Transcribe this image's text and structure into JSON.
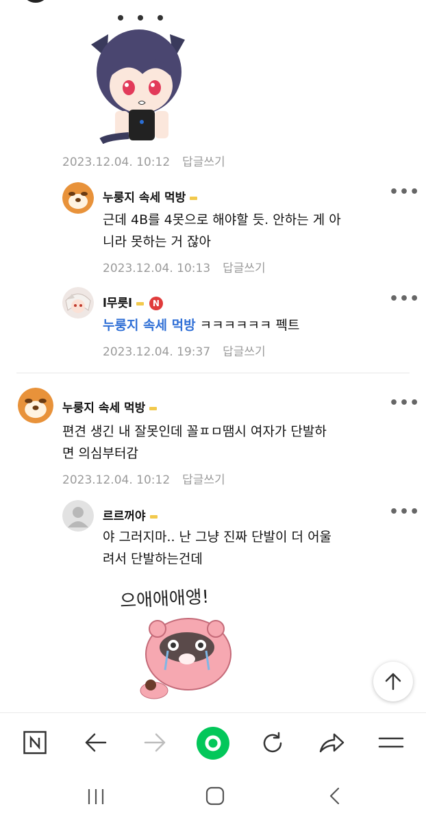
{
  "comments": [
    {
      "author": "누룽지 속세 먹방",
      "text_lines": [
        "근데 4B를 4못으로 해야할 듯. 안하는 게 아",
        "니라 못하는 거 잖아"
      ],
      "date": "2023.12.04. 10:13",
      "reply_label": "답글쓰기"
    },
    {
      "author": "l무릇l",
      "badge": "N",
      "mention": "누룽지 속세 먹방",
      "text": "ㅋㅋㅋㅋㅋㅋ 펙트",
      "date": "2023.12.04. 19:37",
      "reply_label": "답글쓰기"
    },
    {
      "author": "누룽지 속세 먹방",
      "text_lines": [
        "편견 생긴 내 잘못인데 꼴ㅍㅁ땜시 여자가 단발하",
        "면 의심부터감"
      ],
      "date": "2023.12.04. 10:12",
      "reply_label": "답글쓰기"
    },
    {
      "author": "르르꺼야",
      "text_lines": [
        "야 그러지마.. 난 그냥 진짜 단발이 더 어울",
        "려서 단발하는건데"
      ],
      "sticker_text": "으애애애앵!"
    }
  ],
  "top_comment_meta": {
    "date": "2023.12.04. 10:12",
    "reply_label": "답글쓰기"
  },
  "more_glyph": "•••",
  "colors": {
    "accent_green": "#03c75a",
    "mention_blue": "#2f6fd6",
    "meta_gray": "#9a9a9a",
    "badge_red": "#e03b3b"
  },
  "bottom_nav": [
    "n-logo-icon",
    "back-arrow-icon",
    "forward-arrow-icon",
    "home-circle-icon",
    "refresh-icon",
    "share-icon",
    "menu-icon"
  ],
  "system_nav": [
    "recents-icon",
    "home-icon",
    "back-icon"
  ]
}
